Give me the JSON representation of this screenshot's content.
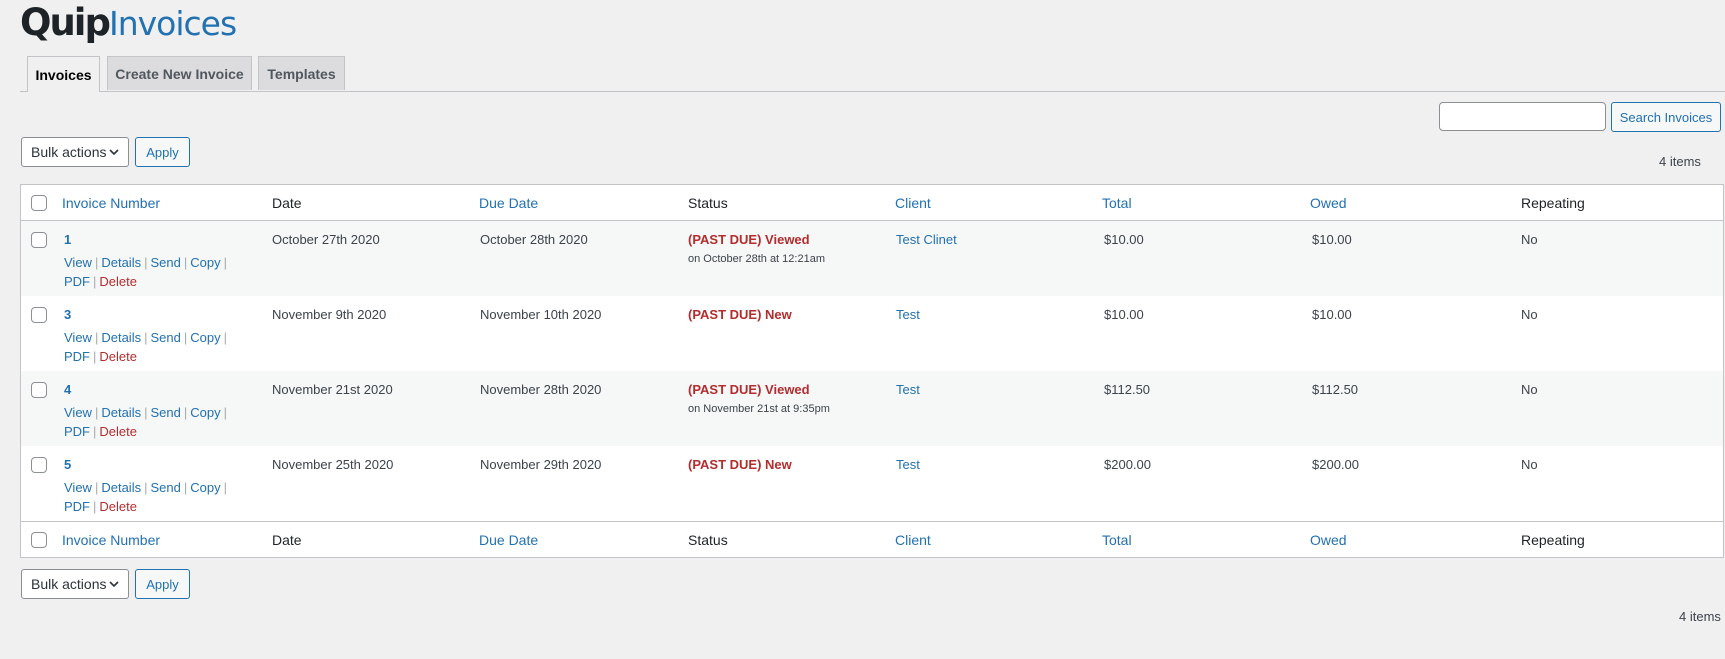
{
  "logo": {
    "part1": "Quip",
    "part2": "Invoices"
  },
  "tabs": [
    {
      "label": "Invoices",
      "active": true
    },
    {
      "label": "Create New Invoice",
      "active": false
    },
    {
      "label": "Templates",
      "active": false
    }
  ],
  "search": {
    "value": "",
    "button_label": "Search Invoices"
  },
  "bulk_top": {
    "selected": "Bulk actions",
    "apply_label": "Apply"
  },
  "bulk_bottom": {
    "selected": "Bulk actions",
    "apply_label": "Apply"
  },
  "item_count": "4 items",
  "columns": {
    "invoice_number": "Invoice Number",
    "date": "Date",
    "due_date": "Due Date",
    "status": "Status",
    "client": "Client",
    "total": "Total",
    "owed": "Owed",
    "repeating": "Repeating"
  },
  "row_actions": {
    "view": "View",
    "details": "Details",
    "send": "Send",
    "copy": "Copy",
    "pdf": "PDF",
    "delete": "Delete",
    "separator": "|"
  },
  "rows": [
    {
      "number": "1",
      "date": "October 27th 2020",
      "due": "October 28th 2020",
      "status": "(PAST DUE) Viewed",
      "status_sub": "on October 28th at 12:21am",
      "client": "Test Clinet",
      "total": "$10.00",
      "owed": "$10.00",
      "repeating": "No"
    },
    {
      "number": "3",
      "date": "November 9th 2020",
      "due": "November 10th 2020",
      "status": "(PAST DUE) New",
      "status_sub": "",
      "client": "Test",
      "total": "$10.00",
      "owed": "$10.00",
      "repeating": "No"
    },
    {
      "number": "4",
      "date": "November 21st 2020",
      "due": "November 28th 2020",
      "status": "(PAST DUE) Viewed",
      "status_sub": "on November 21st at 9:35pm",
      "client": "Test",
      "total": "$112.50",
      "owed": "$112.50",
      "repeating": "No"
    },
    {
      "number": "5",
      "date": "November 25th 2020",
      "due": "November 29th 2020",
      "status": "(PAST DUE) New",
      "status_sub": "",
      "client": "Test",
      "total": "$200.00",
      "owed": "$200.00",
      "repeating": "No"
    }
  ],
  "colors": {
    "accent": "#2271b1",
    "danger": "#b32d2e",
    "background": "#f0f0f1"
  }
}
